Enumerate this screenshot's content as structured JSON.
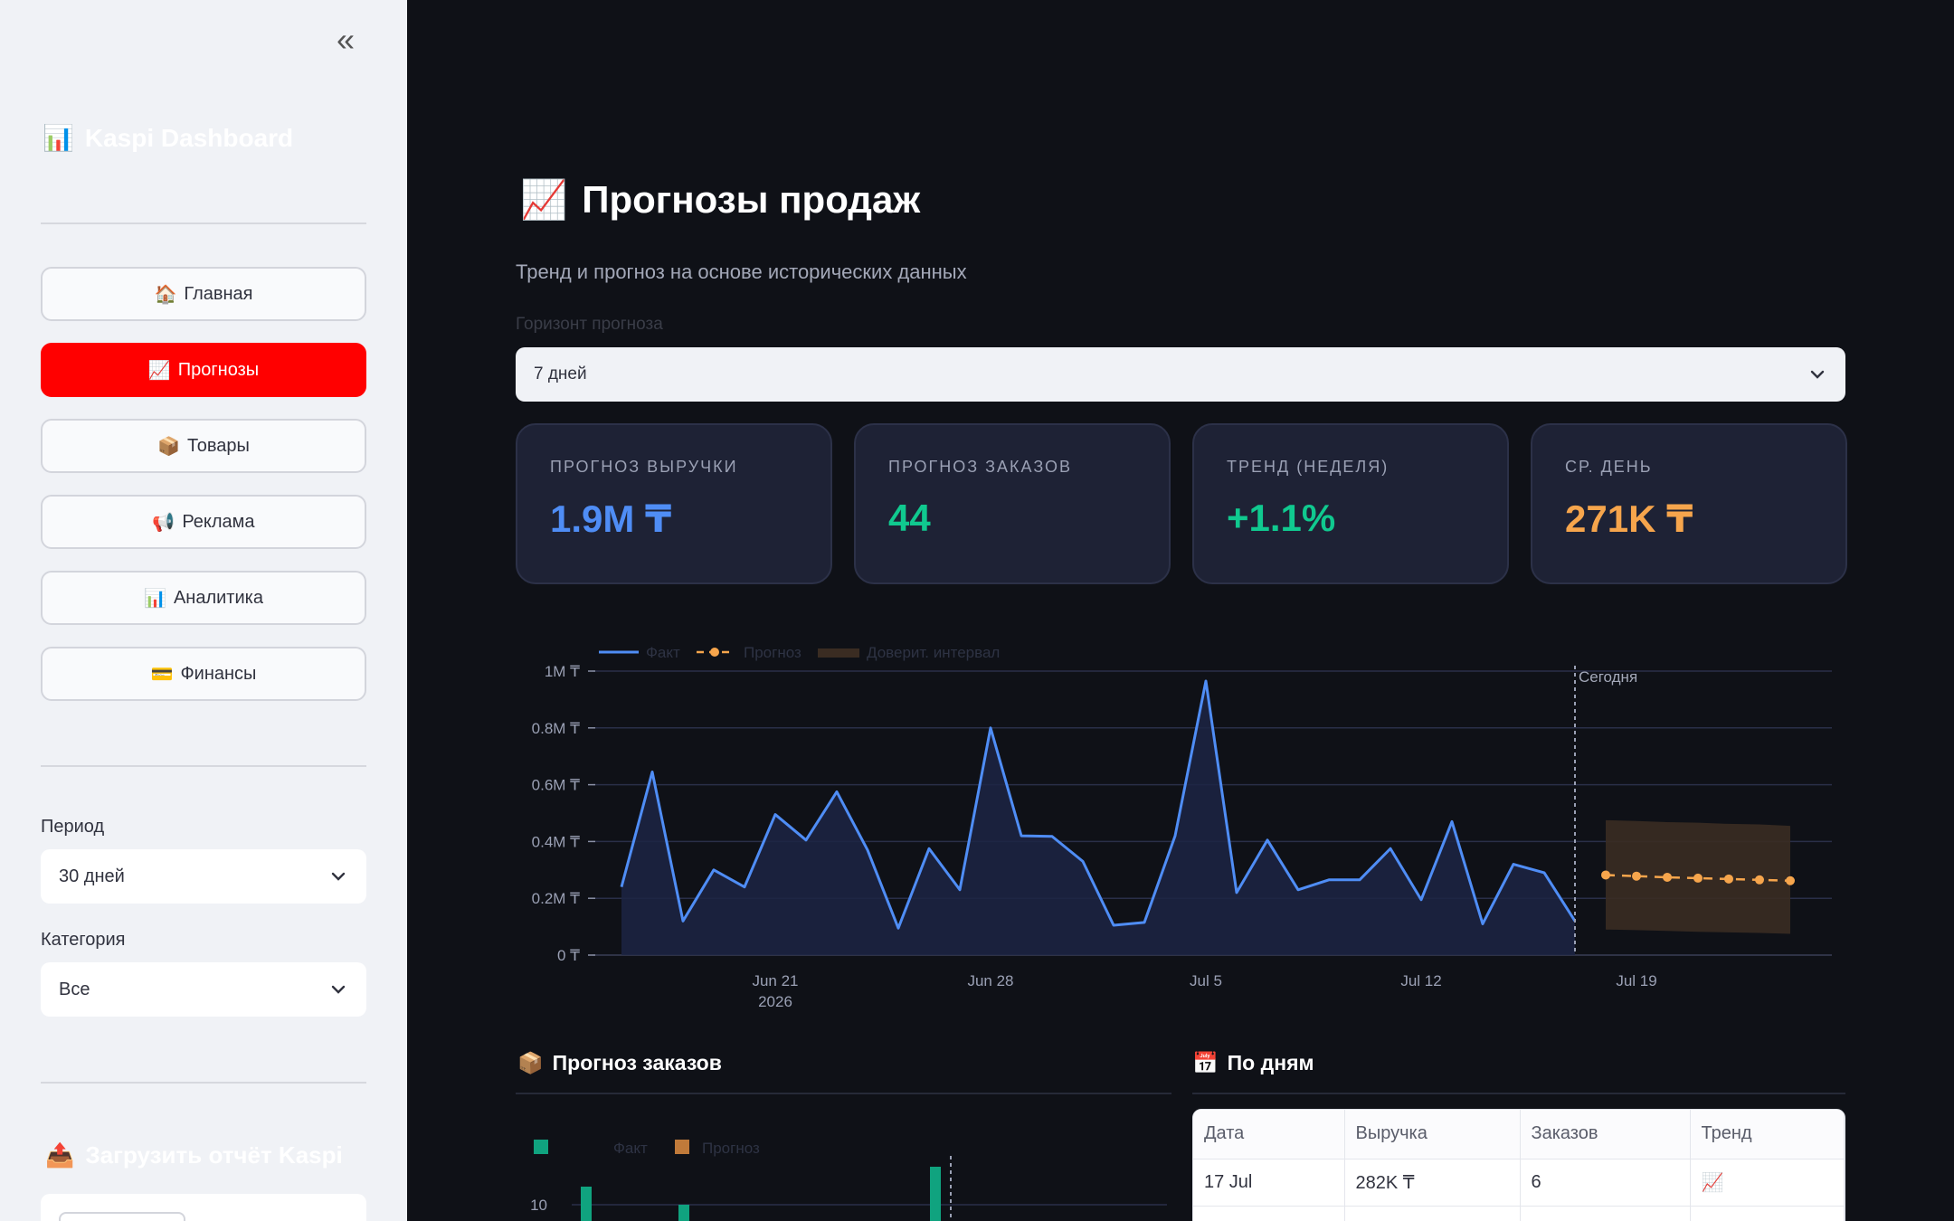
{
  "sidebar": {
    "collapse_icon": "«",
    "brand": {
      "icon": "📊",
      "title": "Kaspi Dashboard"
    },
    "nav": [
      {
        "icon": "🏠",
        "label": "Главная",
        "active": false
      },
      {
        "icon": "📈",
        "label": "Прогнозы",
        "active": true
      },
      {
        "icon": "📦",
        "label": "Товары",
        "active": false
      },
      {
        "icon": "📢",
        "label": "Реклама",
        "active": false
      },
      {
        "icon": "📊",
        "label": "Аналитика",
        "active": false
      },
      {
        "icon": "💳",
        "label": "Финансы",
        "active": false
      }
    ],
    "period": {
      "label": "Период",
      "value": "30 дней"
    },
    "category": {
      "label": "Категория",
      "value": "Все"
    },
    "upload": {
      "icon": "📤",
      "title": "Загрузить отчёт Kaspi"
    }
  },
  "main": {
    "title": {
      "icon": "📈",
      "text": "Прогнозы продаж"
    },
    "subtitle": "Тренд и прогноз на основе исторических данных",
    "horizon": {
      "label": "Горизонт прогноза",
      "value": "7 дней"
    },
    "kpis": [
      {
        "label": "ПРОГНОЗ ВЫРУЧКИ",
        "value": "1.9M ₸",
        "color": "#4f8df5"
      },
      {
        "label": "ПРОГНОЗ ЗАКАЗОВ",
        "value": "44",
        "color": "#10c98f"
      },
      {
        "label": "ТРЕНД (НЕДЕЛЯ)",
        "value": "+1.1%",
        "color": "#10c98f"
      },
      {
        "label": "СР. ДЕНЬ",
        "value": "271K ₸",
        "color": "#f6a54c"
      }
    ],
    "orders_section": {
      "icon": "📦",
      "title": "Прогноз заказов"
    },
    "daily_section": {
      "icon": "📅",
      "title": "По дням"
    },
    "daily_table": {
      "headers": [
        "Дата",
        "Выручка",
        "Заказов",
        "Тренд"
      ],
      "rows": [
        [
          "17 Jul",
          "282K ₸",
          "6",
          "📈"
        ]
      ]
    }
  },
  "chart_data": [
    {
      "type": "area",
      "legend": [
        "Факт",
        "Прогноз",
        "Доверит. интервал"
      ],
      "legend_placement": "top-left",
      "y_ticks": [
        "0 ₸",
        "0.2M ₸",
        "0.4M ₸",
        "0.6M ₸",
        "0.8M ₸",
        "1M ₸"
      ],
      "ylim": [
        0,
        1000000
      ],
      "x_ticks": [
        "Jun 21",
        "Jun 28",
        "Jul 5",
        "Jul 12",
        "Jul 19"
      ],
      "x_tick_sublabel": "2026",
      "today_label": "Сегодня",
      "today": "2026-07-17",
      "grid": true,
      "colors": {
        "fact": "#4f8df5",
        "forecast": "#f6a54c",
        "interval": "#3a2c22"
      },
      "series": [
        {
          "name": "Факт",
          "x": [
            "2026-06-16",
            "2026-06-17",
            "2026-06-18",
            "2026-06-19",
            "2026-06-20",
            "2026-06-21",
            "2026-06-22",
            "2026-06-23",
            "2026-06-24",
            "2026-06-25",
            "2026-06-26",
            "2026-06-27",
            "2026-06-28",
            "2026-06-29",
            "2026-06-30",
            "2026-07-01",
            "2026-07-02",
            "2026-07-03",
            "2026-07-04",
            "2026-07-05",
            "2026-07-06",
            "2026-07-07",
            "2026-07-08",
            "2026-07-09",
            "2026-07-10",
            "2026-07-11",
            "2026-07-12",
            "2026-07-13",
            "2026-07-14",
            "2026-07-15",
            "2026-07-16",
            "2026-07-17"
          ],
          "y": [
            240000,
            645000,
            120000,
            300000,
            240000,
            495000,
            405000,
            575000,
            370000,
            95000,
            375000,
            230000,
            800000,
            420000,
            418000,
            330000,
            105000,
            115000,
            420000,
            965000,
            220000,
            405000,
            230000,
            265000,
            265000,
            375000,
            195000,
            470000,
            110000,
            320000,
            290000,
            120000
          ]
        },
        {
          "name": "Прогноз",
          "x": [
            "2026-07-18",
            "2026-07-19",
            "2026-07-20",
            "2026-07-21",
            "2026-07-22",
            "2026-07-23",
            "2026-07-24"
          ],
          "y": [
            282000,
            278000,
            274000,
            271000,
            268000,
            265000,
            262000
          ],
          "lower": [
            90000,
            88000,
            85000,
            82000,
            80000,
            78000,
            75000
          ],
          "upper": [
            475000,
            472000,
            468000,
            466000,
            462000,
            460000,
            455000
          ]
        }
      ]
    },
    {
      "type": "bar",
      "legend": [
        "Факт",
        "Прогноз"
      ],
      "y_ticks": [
        "10"
      ],
      "colors": {
        "fact": "#10a37f",
        "forecast": "#c07a3a"
      }
    }
  ]
}
